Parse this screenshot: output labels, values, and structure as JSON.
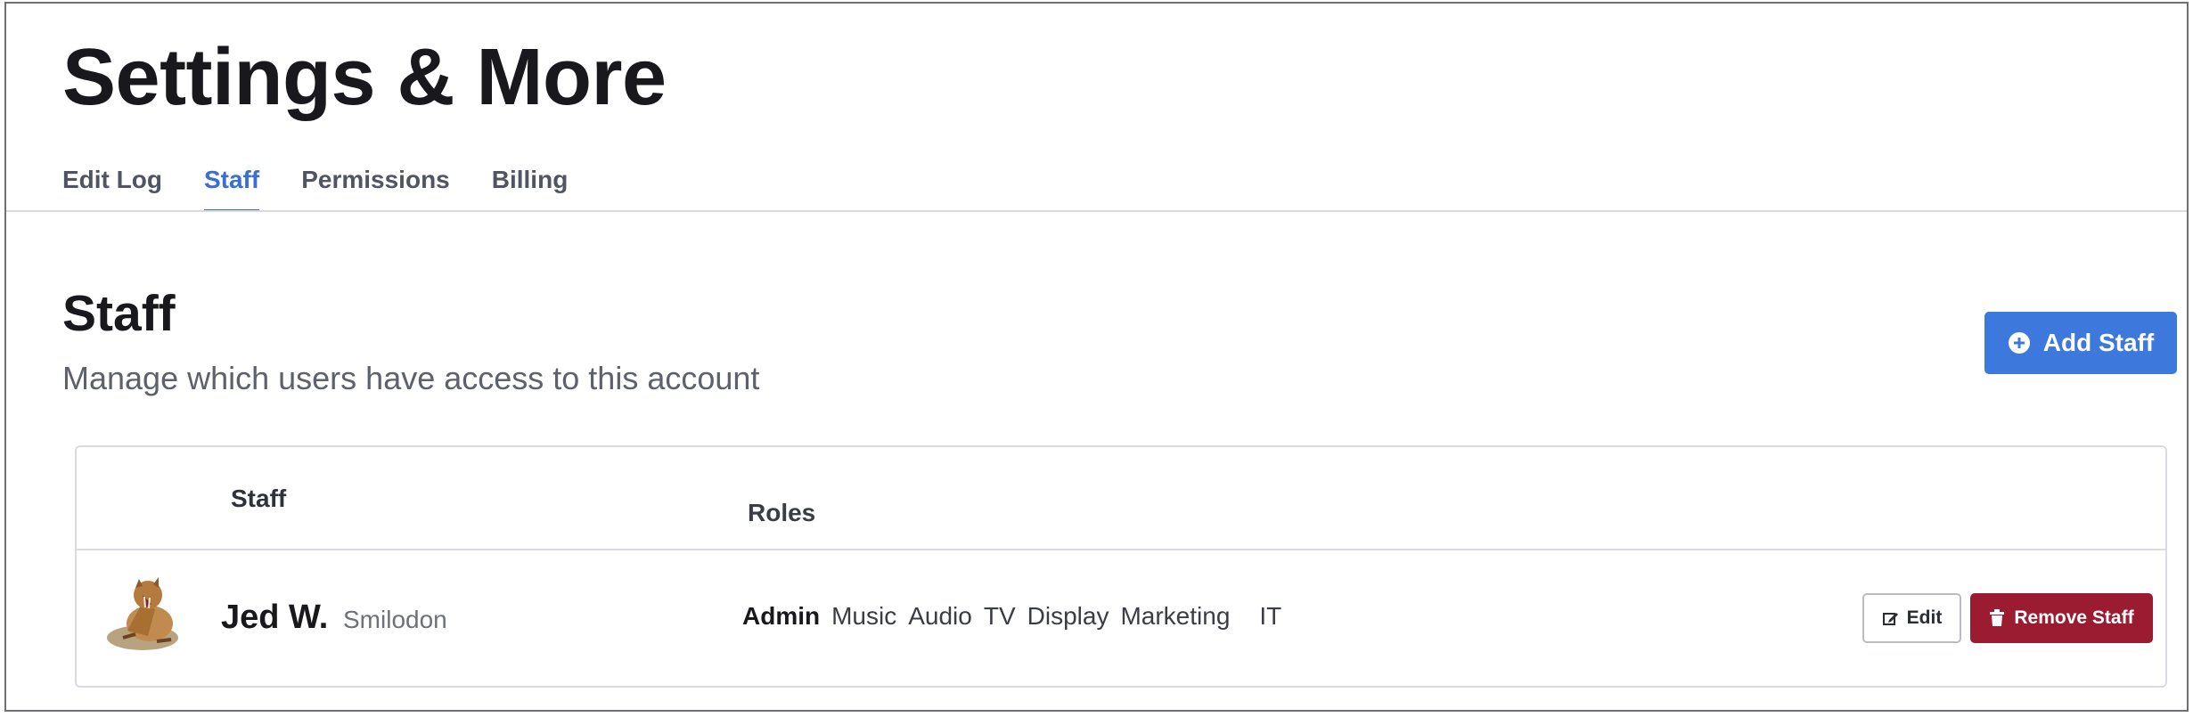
{
  "page": {
    "title": "Settings & More"
  },
  "tabs": [
    {
      "label": "Edit Log",
      "active": false
    },
    {
      "label": "Staff",
      "active": true
    },
    {
      "label": "Permissions",
      "active": false
    },
    {
      "label": "Billing",
      "active": false
    }
  ],
  "section": {
    "title": "Staff",
    "description": "Manage which users have access to this account",
    "add_button_label": "Add Staff",
    "add_button_icon": "plus-circle-icon"
  },
  "table": {
    "columns": [
      "Staff",
      "Roles"
    ],
    "rows": [
      {
        "name": "Jed W.",
        "species": "Smilodon",
        "avatar": "smilodon-avatar",
        "roles": [
          "Admin",
          "Music",
          "Audio",
          "TV",
          "Display",
          "Marketing",
          "IT"
        ],
        "edit_label": "Edit",
        "edit_icon": "edit-icon",
        "remove_label": "Remove Staff",
        "remove_icon": "trash-icon"
      }
    ]
  },
  "colors": {
    "accent": "#3d78dd",
    "active_tab": "#3a6fd1",
    "danger": "#9b1c31",
    "border": "#d9dbe0"
  }
}
